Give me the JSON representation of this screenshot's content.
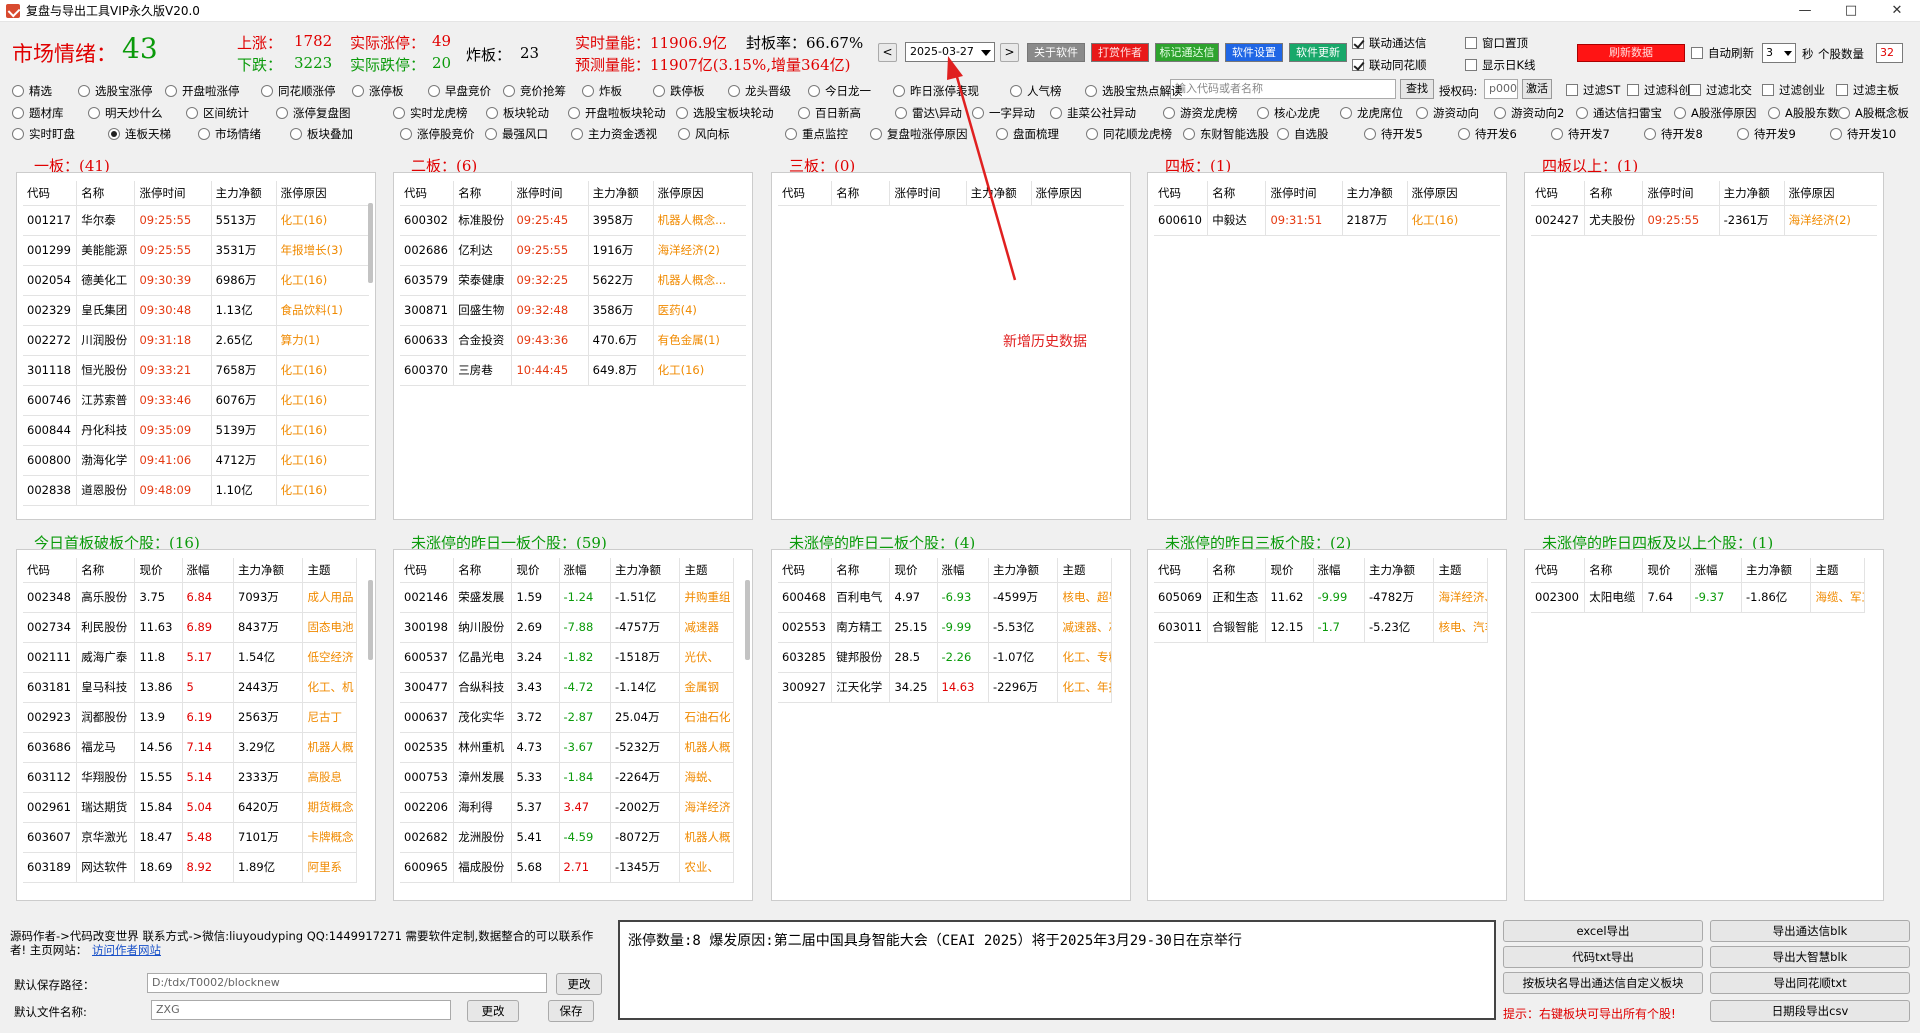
{
  "window": {
    "title": "复盘与导出工具VIP永久版V20.0",
    "min": "—",
    "max": "□",
    "close": "✕"
  },
  "header": {
    "mood_label": "市场情绪：",
    "mood_value": "43",
    "up_label": "上涨：",
    "up_value": "1782",
    "real_limit_up_label": "实际涨停：",
    "real_limit_up_value": "49",
    "down_label": "下跌：",
    "down_value": "3223",
    "real_limit_down_label": "实际跌停：",
    "real_limit_down_value": "20",
    "broken_label": "炸板：",
    "broken_value": "23",
    "realtime_vol": "实时量能：11906.9亿",
    "seal_rate": "封板率：66.67%",
    "predict_vol": "预测量能：11907亿(3.15%,增量364亿)",
    "date": "2025-03-27",
    "prev": "<",
    "next": ">",
    "buttons": [
      "关于软件",
      "打赏作者",
      "标记通达信",
      "软件设置",
      "软件更新"
    ],
    "link_tdx": "联动通达信",
    "link_ths": "联动同花顺",
    "window_top": "窗口置顶",
    "show_daily": "显示日K线",
    "refresh_btn": "刷新数据",
    "auto_refresh": "自动刷新",
    "refresh_interval": "3",
    "seconds_label": "秒",
    "stock_count_label": "个股数量",
    "stock_count": "32"
  },
  "colors": {
    "up": "#e00000",
    "down": "#0a9a0a",
    "time": "#e53a12",
    "reason": "#f08a00"
  },
  "radios": {
    "row1": [
      "精选",
      "选股宝涨停",
      "开盘啦涨停",
      "同花顺涨停",
      "涨停板",
      "早盘竞价",
      "竞价抢筹",
      "炸板",
      "跌停板",
      "龙头晋级",
      "今日龙一",
      "昨日涨停表现",
      "人气榜",
      "选股宝热点解读"
    ],
    "row1_extra": [
      "过滤ST",
      "过滤科创",
      "过滤北交",
      "过滤创业",
      "过滤主板"
    ],
    "row2": [
      "题材库",
      "明天炒什么",
      "区间统计",
      "涨停复盘图",
      "实时龙虎榜",
      "板块轮动",
      "开盘啦板块轮动",
      "选股宝板块轮动",
      "百日新高",
      "雷达\\异动",
      "一字异动",
      "韭菜公社异动",
      "游资龙虎榜",
      "核心龙虎",
      "龙虎席位",
      "游资动向",
      "游资动向2",
      "通达信扫雷宝",
      "A股涨停原因",
      "A股股东数",
      "A股概念板"
    ],
    "row3": [
      "实时盯盘",
      "连板天梯",
      "市场情绪",
      "板块叠加",
      "涨停股竞价",
      "最强风口",
      "主力资金透视",
      "风向标",
      "重点监控",
      "复盘啦涨停原因",
      "盘面梳理",
      "同花顺龙虎榜",
      "东财智能选股",
      "自选股",
      "待开发5",
      "待开发6",
      "待开发7",
      "待开发8",
      "待开发9",
      "待开发10"
    ],
    "search_placeholder": "输入代码或者名称",
    "search_btn": "查找",
    "auth_label": "授权码:",
    "auth_value": "p000",
    "activate_btn": "激活"
  },
  "cols_a": [
    "代码",
    "名称",
    "涨停时间",
    "主力净额",
    "涨停原因"
  ],
  "cols_b": [
    "代码",
    "名称",
    "现价",
    "涨幅",
    "主力净额",
    "主题"
  ],
  "board1": {
    "title": "一板：(41)",
    "rows": [
      [
        "001217",
        "华尔泰",
        "09:25:55",
        "5513万",
        "化工(16)"
      ],
      [
        "001299",
        "美能能源",
        "09:25:55",
        "3531万",
        "年报增长(3)"
      ],
      [
        "002054",
        "德美化工",
        "09:30:39",
        "6986万",
        "化工(16)"
      ],
      [
        "002329",
        "皇氏集团",
        "09:30:48",
        "1.13亿",
        "食品饮料(1)"
      ],
      [
        "002272",
        "川润股份",
        "09:31:18",
        "2.65亿",
        "算力(1)"
      ],
      [
        "301118",
        "恒光股份",
        "09:33:21",
        "7658万",
        "化工(16)"
      ],
      [
        "600746",
        "江苏索普",
        "09:33:46",
        "6076万",
        "化工(16)"
      ],
      [
        "600844",
        "丹化科技",
        "09:35:09",
        "5139万",
        "化工(16)"
      ],
      [
        "600800",
        "渤海化学",
        "09:41:06",
        "4712万",
        "化工(16)"
      ],
      [
        "002838",
        "道恩股份",
        "09:48:09",
        "1.10亿",
        "化工(16)"
      ]
    ]
  },
  "board2": {
    "title": "二板：(6)",
    "rows": [
      [
        "600302",
        "标准股份",
        "09:25:45",
        "3958万",
        "机器人概念..."
      ],
      [
        "002686",
        "亿利达",
        "09:25:55",
        "1916万",
        "海洋经济(2)"
      ],
      [
        "603579",
        "荣泰健康",
        "09:32:25",
        "5622万",
        "机器人概念..."
      ],
      [
        "300871",
        "回盛生物",
        "09:32:48",
        "3586万",
        "医药(4)"
      ],
      [
        "600633",
        "合金投资",
        "09:43:36",
        "470.6万",
        "有色金属(1)"
      ],
      [
        "600370",
        "三房巷",
        "10:44:45",
        "649.8万",
        "化工(16)"
      ]
    ]
  },
  "board3": {
    "title": "三板：(0)",
    "rows": []
  },
  "board4": {
    "title": "四板：(1)",
    "rows": [
      [
        "600610",
        "中毅达",
        "09:31:51",
        "2187万",
        "化工(16)"
      ]
    ]
  },
  "board5": {
    "title": "四板以上：(1)",
    "rows": [
      [
        "002427",
        "尤夫股份",
        "09:25:55",
        "-2361万",
        "海洋经济(2)"
      ]
    ]
  },
  "broken": {
    "title": "今日首板破板个股：(16)",
    "rows": [
      [
        "002348",
        "高乐股份",
        "3.75",
        "6.84",
        "7093万",
        "成人用品"
      ],
      [
        "002734",
        "利民股份",
        "11.63",
        "6.89",
        "8437万",
        "固态电池"
      ],
      [
        "002111",
        "威海广泰",
        "11.8",
        "5.17",
        "1.54亿",
        "低空经济"
      ],
      [
        "603181",
        "皇马科技",
        "13.86",
        "5",
        "2443万",
        "化工、机"
      ],
      [
        "002923",
        "润都股份",
        "13.9",
        "6.19",
        "2563万",
        "尼古丁"
      ],
      [
        "603686",
        "福龙马",
        "14.56",
        "7.14",
        "3.29亿",
        "机器人概"
      ],
      [
        "603112",
        "华翔股份",
        "15.55",
        "5.14",
        "2333万",
        "高股息"
      ],
      [
        "002961",
        "瑞达期货",
        "15.84",
        "5.04",
        "6420万",
        "期货概念"
      ],
      [
        "603607",
        "京华激光",
        "18.47",
        "5.48",
        "7101万",
        "卡牌概念"
      ],
      [
        "603189",
        "网达软件",
        "18.69",
        "8.92",
        "1.89亿",
        "阿里系"
      ]
    ]
  },
  "y1": {
    "title": "未涨停的昨日一板个股：(59)",
    "rows": [
      [
        "002146",
        "荣盛发展",
        "1.59",
        "-1.24",
        "-1.51亿",
        "并购重组"
      ],
      [
        "300198",
        "纳川股份",
        "2.69",
        "-7.88",
        "-4757万",
        "减速器"
      ],
      [
        "600537",
        "亿晶光电",
        "3.24",
        "-1.82",
        "-1518万",
        "光伏、"
      ],
      [
        "300477",
        "合纵科技",
        "3.43",
        "-4.72",
        "-1.14亿",
        "金属钢"
      ],
      [
        "000637",
        "茂化实华",
        "3.72",
        "-2.87",
        "25.04万",
        "石油石化"
      ],
      [
        "002535",
        "林州重机",
        "4.73",
        "-3.67",
        "-5232万",
        "机器人概"
      ],
      [
        "000753",
        "漳州发展",
        "5.33",
        "-1.84",
        "-2264万",
        "海蜕、"
      ],
      [
        "002206",
        "海利得",
        "5.37",
        "3.47",
        "-2002万",
        "海洋经济"
      ],
      [
        "002682",
        "龙洲股份",
        "5.41",
        "-4.59",
        "-8072万",
        "机器人概"
      ],
      [
        "600965",
        "福成股份",
        "5.68",
        "2.71",
        "-1345万",
        "农业、"
      ]
    ]
  },
  "y2": {
    "title": "未涨停的昨日二板个股：(4)",
    "rows": [
      [
        "600468",
        "百利电气",
        "4.97",
        "-6.93",
        "-4599万",
        "核电、超导"
      ],
      [
        "002553",
        "南方精工",
        "25.15",
        "-9.99",
        "-5.53亿",
        "减速器、芯"
      ],
      [
        "603285",
        "键邦股份",
        "28.5",
        "-2.26",
        "-1.07亿",
        "化工、专精"
      ],
      [
        "300927",
        "江天化学",
        "34.25",
        "14.63",
        "-2296万",
        "化工、年报"
      ]
    ]
  },
  "y3": {
    "title": "未涨停的昨日三板个股：(2)",
    "rows": [
      [
        "605069",
        "正和生态",
        "11.62",
        "-9.99",
        "-4782万",
        "海洋经济、"
      ],
      [
        "603011",
        "合锻智能",
        "12.15",
        "-1.7",
        "-5.23亿",
        "核电、汽车"
      ]
    ]
  },
  "y4": {
    "title": "未涨停的昨日四板及以上个股：(1)",
    "rows": [
      [
        "002300",
        "太阳电缆",
        "7.64",
        "-9.37",
        "-1.86亿",
        "海缆、军工"
      ]
    ]
  },
  "annotation": "新增历史数据",
  "footer": {
    "author": "源码作者->代码改变世界 联系方式->微信:liuyoudyping QQ:1449917271 需要软件定制,数据整合的可以联系作",
    "author2": "者! 主页网站：",
    "site_link": "访问作者网站",
    "save_path_label": "默认保存路径：",
    "save_path": "D:/tdx/T0002/blocknew",
    "change_btn": "更改",
    "file_name_label": "默认文件名称:",
    "file_name": "ZXG",
    "change_btn2": "更改",
    "save_btn": "保存",
    "info": "涨停数量:8   爆发原因:第二届中国具身智能大会（CEAI 2025）将于2025年3月29-30日在京举行",
    "export_buttons": [
      "excel导出",
      "导出通达信blk",
      "代码txt导出",
      "导出大智慧blk",
      "按板块名导出通达信自定义板块",
      "导出同花顺txt",
      "日期段导出csv"
    ],
    "tip": "提示：右键板块可导出所有个股!"
  }
}
